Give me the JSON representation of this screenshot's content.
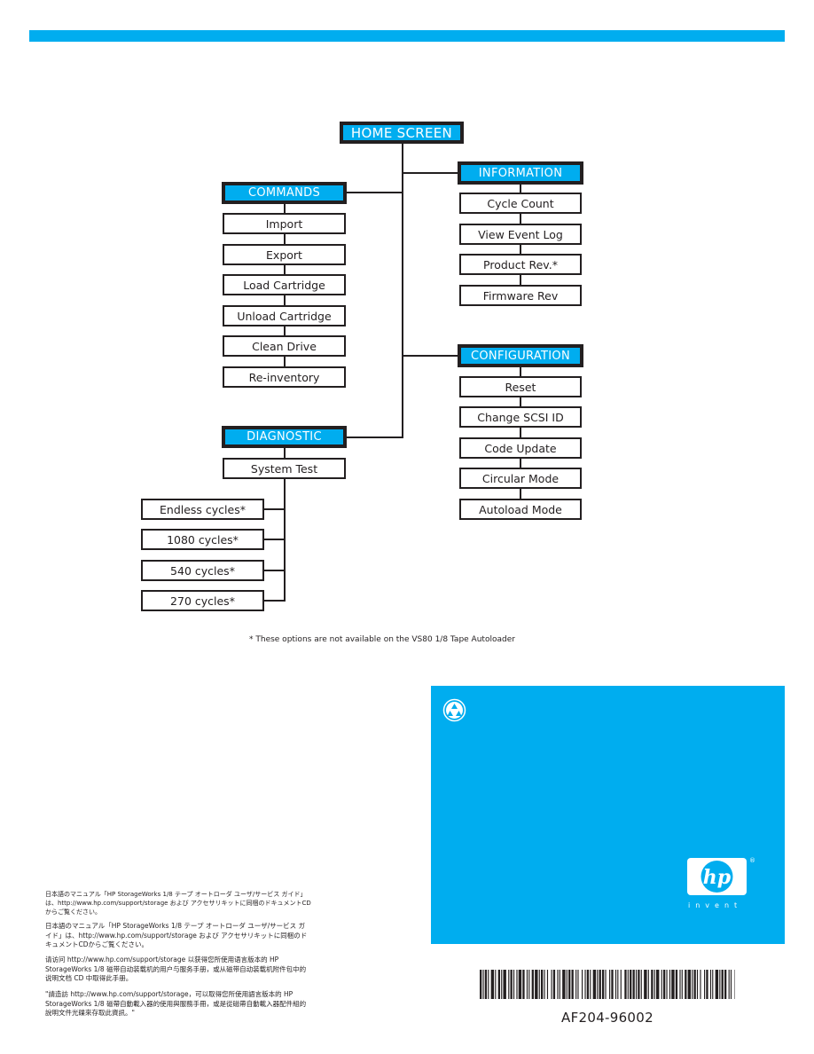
{
  "colors": {
    "accent": "#00adef",
    "line": "#231f20",
    "text": "#231f20"
  },
  "home": {
    "label": "HOME SCREEN"
  },
  "commands": {
    "label": "COMMANDS",
    "items": [
      "Import",
      "Export",
      "Load Cartridge",
      "Unload Cartridge",
      "Clean Drive",
      "Re-inventory"
    ]
  },
  "information": {
    "label": "INFORMATION",
    "items": [
      "Cycle Count",
      "View Event Log",
      "Product Rev.*",
      "Firmware Rev"
    ]
  },
  "configuration": {
    "label": "CONFIGURATION",
    "items": [
      "Reset",
      "Change SCSI ID",
      "Code Update",
      "Circular Mode",
      "Autoload Mode"
    ]
  },
  "diagnostic": {
    "label": "DIAGNOSTIC",
    "items": [
      "System Test"
    ],
    "sub_items": [
      "Endless cycles*",
      "1080 cycles*",
      "540 cycles*",
      "270 cycles*"
    ]
  },
  "footnote": "* These options are not available on the VS80 1/8 Tape Autoloader",
  "panel": {
    "recycle_icon": "recycle-icon",
    "logo_text": "hp",
    "registered": "®",
    "tagline": "invent"
  },
  "international": [
    "日本語のマニュアル「HP StorageWorks 1/8 テープ オートローダ ユーザ/サービス ガイド」は、http://www.hp.com/support/storage および アクセサリキットに同梱のドキュメントCDからご覧ください。",
    "日本語のマニュアル「HP StorageWorks 1/8 テープ オートローダ ユーザ/サービス ガイド」は、http://www.hp.com/support/storage および アクセサリキットに同梱のドキュメントCDからご覧ください。",
    "请访问 http://www.hp.com/support/storage 以获得您所使用语言版本的 HP StorageWorks 1/8 磁带自动装载机的用户与服务手册，或从磁带自动装载机附件包中的说明文档 CD 中取得此手册。",
    "\"請造訪 http://www.hp.com/support/storage，可以取得您所使用語言版本的 HP StorageWorks 1/8 磁帶自動載入器的使用與服務手冊，或是從磁帶自動載入器配件組的說明文件光碟來存取此資訊。\""
  ],
  "part_number": "AF204-96002"
}
